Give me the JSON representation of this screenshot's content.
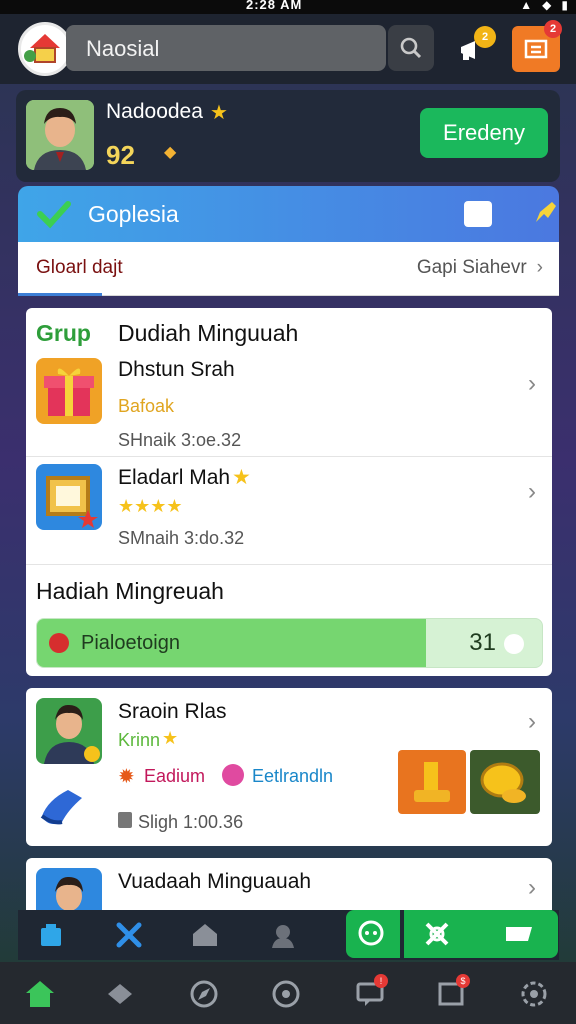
{
  "status_bar": {
    "time": "2:28 AM",
    "icons": [
      "signal-icon",
      "wifi-icon",
      "battery-icon"
    ]
  },
  "app_bar": {
    "search_text": "Naosial",
    "megaphone_badge": "2",
    "notification_badge": "2"
  },
  "profile": {
    "name": "Nadoodea",
    "score": "92",
    "action_label": "Eredeny"
  },
  "group": {
    "title": "Goplesia",
    "tab_left": "Gloarl dajt",
    "tab_right": "Gapi Siahevr"
  },
  "list": {
    "group_label": "Grup",
    "group_title": "Dudiah Minguuah",
    "items": [
      {
        "title": "Dhstun Srah",
        "subtitle": "Bafoak",
        "meta": "SHnaik 3:oe.32"
      },
      {
        "title": "Eladarl Mah",
        "subtitle": "",
        "meta": "SMnaih 3:do.32"
      }
    ],
    "section_title": "Hadiah Mingreuah",
    "progress": {
      "label": "Pialoetoign",
      "value": "31",
      "fraction": 0.77
    }
  },
  "card2": {
    "title": "Sraoin Rlas",
    "subtitle": "Krinn",
    "tag1": "Eadium",
    "tag2": "Eetlrandln",
    "meta": "Sligh 1:00.36"
  },
  "card3": {
    "title": "Vuadaah Minguauah"
  },
  "colors": {
    "accent_green": "#1bb85c",
    "header_blue": "#4b78e0",
    "orange": "#f07a25",
    "star_gold": "#f6c21b"
  }
}
